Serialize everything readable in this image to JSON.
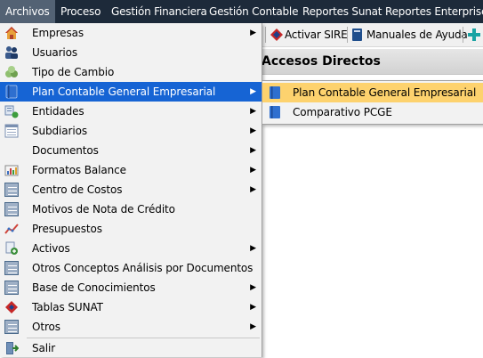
{
  "menubar": {
    "items": [
      {
        "label": "Archivos"
      },
      {
        "label": "Proceso"
      },
      {
        "label": "Gestión Financiera"
      },
      {
        "label": "Gestión Contable"
      },
      {
        "label": "Reportes Sunat"
      },
      {
        "label": "Reportes Enterprise"
      }
    ]
  },
  "toolbar": {
    "activar_sire": "Activar SIRE",
    "manuales": "Manuales de Ayuda"
  },
  "panel": {
    "title": "Accesos Directos"
  },
  "archivos_menu": {
    "items": [
      {
        "label": "Empresas",
        "submenu": true,
        "icon": "home-icon"
      },
      {
        "label": "Usuarios",
        "submenu": false,
        "icon": "users-icon"
      },
      {
        "label": "Tipo de Cambio",
        "submenu": false,
        "icon": "exchange-icon"
      },
      {
        "label": "Plan Contable General Empresarial",
        "submenu": true,
        "icon": "book-icon",
        "highlighted": true
      },
      {
        "label": "Entidades",
        "submenu": true,
        "icon": "entities-icon"
      },
      {
        "label": "Subdiarios",
        "submenu": true,
        "icon": "subdiarios-icon"
      },
      {
        "label": "Documentos",
        "submenu": true,
        "icon": ""
      },
      {
        "label": "Formatos Balance",
        "submenu": true,
        "icon": "chart-icon"
      },
      {
        "label": "Centro de Costos",
        "submenu": true,
        "icon": "form-icon"
      },
      {
        "label": "Motivos de Nota de Crédito",
        "submenu": false,
        "icon": "form-icon"
      },
      {
        "label": "Presupuestos",
        "submenu": false,
        "icon": "trend-icon"
      },
      {
        "label": "Activos",
        "submenu": true,
        "icon": "assets-icon"
      },
      {
        "label": "Otros Conceptos Análisis por Documentos",
        "submenu": false,
        "icon": "form-icon"
      },
      {
        "label": "Base de Conocimientos",
        "submenu": true,
        "icon": "form-icon"
      },
      {
        "label": "Tablas SUNAT",
        "submenu": true,
        "icon": "sunat-icon"
      },
      {
        "label": "Otros",
        "submenu": true,
        "icon": "form-icon"
      },
      {
        "label": "Salir",
        "submenu": false,
        "icon": "exit-icon"
      }
    ]
  },
  "submenu": {
    "items": [
      {
        "label": "Plan Contable General Empresarial",
        "highlighted": true
      },
      {
        "label": "Comparativo PCGE"
      }
    ]
  },
  "colors": {
    "menubar_bg": "#1d2a3a",
    "menubar_active": "#536274",
    "menu_highlight": "#1664d4",
    "submenu_highlight": "#fdd26e"
  }
}
